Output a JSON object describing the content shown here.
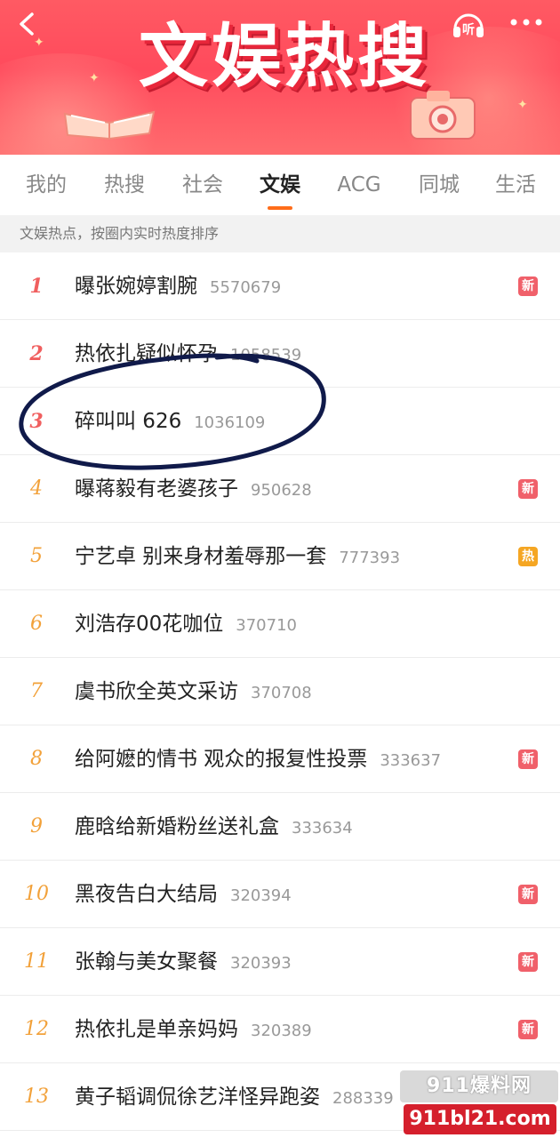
{
  "header": {
    "banner_title": "文娱热搜",
    "listen_label": "听",
    "back_icon": "back-chevron-icon",
    "more_icon": "more-dots-icon",
    "accent_color": "#ff5a63"
  },
  "tabs": [
    {
      "label": "我的",
      "active": false
    },
    {
      "label": "热搜",
      "active": false
    },
    {
      "label": "社会",
      "active": false
    },
    {
      "label": "文娱",
      "active": true
    },
    {
      "label": "ACG",
      "active": false
    },
    {
      "label": "同城",
      "active": false
    },
    {
      "label": "生活",
      "active": false
    }
  ],
  "hint": "文娱热点，按圈内实时热度排序",
  "list": [
    {
      "rank": "1",
      "title": "曝张婉婷割腕",
      "count": "5570679",
      "badge": "新",
      "badge_type": "new"
    },
    {
      "rank": "2",
      "title": "热依扎疑似怀孕",
      "count": "1058539",
      "badge": "",
      "badge_type": ""
    },
    {
      "rank": "3",
      "title": "碎叫叫 626",
      "count": "1036109",
      "badge": "",
      "badge_type": ""
    },
    {
      "rank": "4",
      "title": "曝蒋毅有老婆孩子",
      "count": "950628",
      "badge": "新",
      "badge_type": "new"
    },
    {
      "rank": "5",
      "title": "宁艺卓 别来身材羞辱那一套",
      "count": "777393",
      "badge": "热",
      "badge_type": "hot"
    },
    {
      "rank": "6",
      "title": "刘浩存00花咖位",
      "count": "370710",
      "badge": "",
      "badge_type": ""
    },
    {
      "rank": "7",
      "title": "虞书欣全英文采访",
      "count": "370708",
      "badge": "",
      "badge_type": ""
    },
    {
      "rank": "8",
      "title": "给阿嬷的情书 观众的报复性投票",
      "count": "333637",
      "badge": "新",
      "badge_type": "new"
    },
    {
      "rank": "9",
      "title": "鹿晗给新婚粉丝送礼盒",
      "count": "333634",
      "badge": "",
      "badge_type": ""
    },
    {
      "rank": "10",
      "title": "黑夜告白大结局",
      "count": "320394",
      "badge": "新",
      "badge_type": "new"
    },
    {
      "rank": "11",
      "title": "张翰与美女聚餐",
      "count": "320393",
      "badge": "新",
      "badge_type": "new"
    },
    {
      "rank": "12",
      "title": "热依扎是单亲妈妈",
      "count": "320389",
      "badge": "新",
      "badge_type": "new"
    },
    {
      "rank": "13",
      "title": "黄子韬调侃徐艺洋怪异跑姿",
      "count": "288339",
      "badge": "",
      "badge_type": ""
    }
  ],
  "watermark": {
    "top": "911爆料网",
    "bottom": "911bl21.com"
  }
}
